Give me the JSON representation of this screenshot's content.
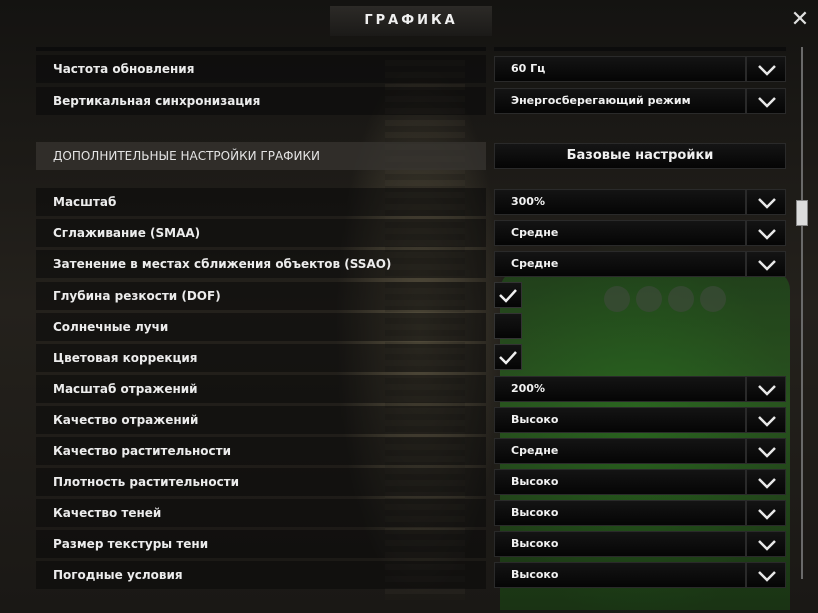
{
  "window": {
    "title": "ГРАФИКА",
    "close_icon": "close-icon"
  },
  "top_rows": [
    {
      "label": "Частота обновления",
      "value": "60 Гц"
    },
    {
      "label": "Вертикальная синхронизация",
      "value": "Энергосберегающий режим"
    }
  ],
  "section": {
    "title": "ДОПОЛНИТЕЛЬНЫЕ НАСТРОЙКИ ГРАФИКИ",
    "button_label": "Базовые настройки"
  },
  "settings": [
    {
      "label": "Масштаб",
      "type": "select",
      "value": "300%"
    },
    {
      "label": "Сглаживание (SMAA)",
      "type": "select",
      "value": "Средне"
    },
    {
      "label": "Затенение в местах сближения объектов (SSAO)",
      "type": "select",
      "value": "Средне"
    },
    {
      "label": "Глубина резкости (DOF)",
      "type": "checkbox",
      "checked": true
    },
    {
      "label": "Солнечные лучи",
      "type": "checkbox",
      "checked": false
    },
    {
      "label": "Цветовая коррекция",
      "type": "checkbox",
      "checked": true
    },
    {
      "label": "Масштаб отражений",
      "type": "select",
      "value": "200%"
    },
    {
      "label": "Качество отражений",
      "type": "select",
      "value": "Высоко"
    },
    {
      "label": "Качество растительности",
      "type": "select",
      "value": "Средне"
    },
    {
      "label": "Плотность растительности",
      "type": "select",
      "value": "Высоко"
    },
    {
      "label": "Качество теней",
      "type": "select",
      "value": "Высоко"
    },
    {
      "label": "Размер текстуры тени",
      "type": "select",
      "value": "Высоко"
    },
    {
      "label": "Погодные условия",
      "type": "select",
      "value": "Высоко"
    }
  ],
  "colors": {
    "accent": "#ffffff",
    "row_bg": "#0a0a0a",
    "truck_green": "#2e7d22"
  }
}
